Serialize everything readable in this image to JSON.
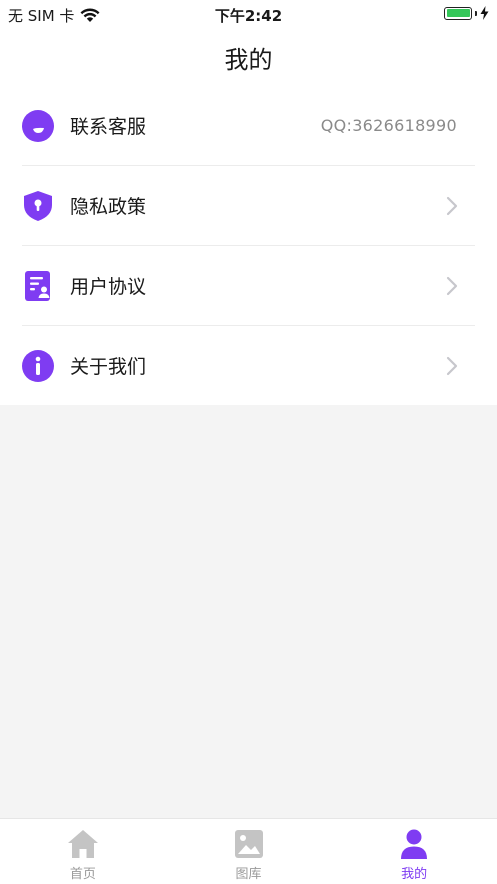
{
  "status_bar": {
    "carrier": "无 SIM 卡",
    "time": "下午2:42",
    "battery_color": "#34c759"
  },
  "nav": {
    "title": "我的"
  },
  "accent_color": "#7f3cf2",
  "menu": [
    {
      "label": "联系客服",
      "value": "QQ:3626618990",
      "icon": "chat-bubble-icon"
    },
    {
      "label": "隐私政策",
      "icon": "shield-lock-icon"
    },
    {
      "label": "用户协议",
      "icon": "document-user-icon"
    },
    {
      "label": "关于我们",
      "icon": "info-icon"
    }
  ],
  "tabs": [
    {
      "label": "首页",
      "icon": "home-icon",
      "active": false
    },
    {
      "label": "图库",
      "icon": "gallery-icon",
      "active": false
    },
    {
      "label": "我的",
      "icon": "user-icon",
      "active": true
    }
  ]
}
